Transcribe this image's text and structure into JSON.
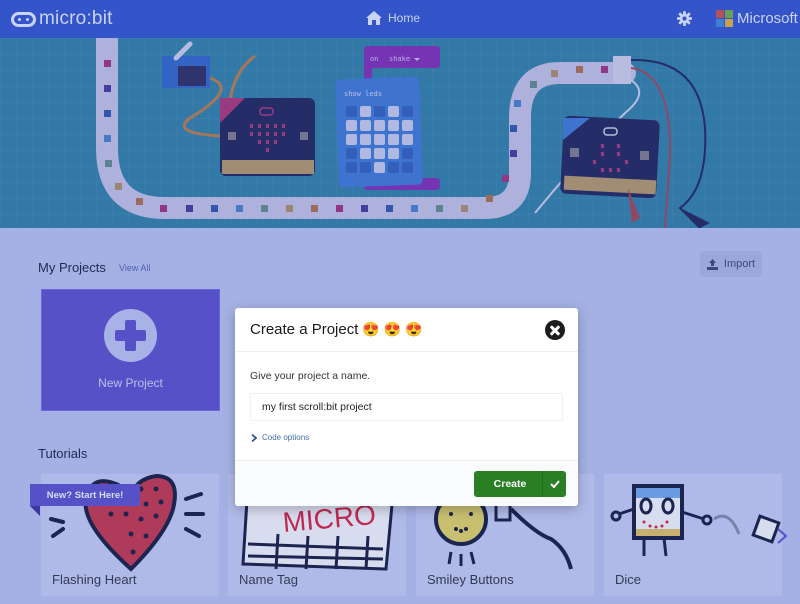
{
  "header": {
    "brand": "micro:bit",
    "home_label": "Home",
    "company": "Microsoft"
  },
  "hero": {
    "block_event": "on",
    "block_event_option": "shake",
    "block_action": "show leds"
  },
  "projects": {
    "title": "My Projects",
    "view_all": "View All",
    "import_label": "Import",
    "new_project_label": "New Project"
  },
  "tutorials": {
    "title": "Tutorials",
    "badge": "New? Start Here!",
    "cards": [
      {
        "label": "Flashing Heart"
      },
      {
        "label": "Name Tag"
      },
      {
        "label": "Smiley Buttons"
      },
      {
        "label": "Dice"
      }
    ]
  },
  "modal": {
    "title": "Create a Project",
    "title_emojis": [
      "😍",
      "😍",
      "😍"
    ],
    "prompt": "Give your project a name.",
    "input_value": "my first scroll:bit project",
    "code_options_label": "Code options",
    "create_label": "Create"
  },
  "colors": {
    "header_bg": "#3454c9",
    "accent_purple": "#5751c8",
    "create_green": "#2a7f24",
    "page_bg": "#a5b1e4"
  }
}
